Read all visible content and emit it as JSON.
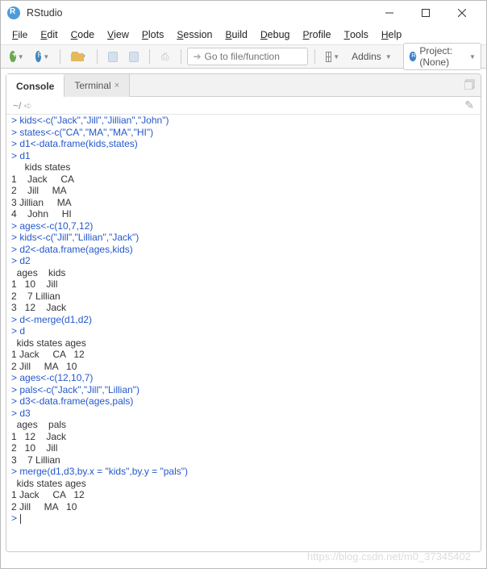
{
  "window": {
    "title": "RStudio"
  },
  "menu": {
    "file": "File",
    "edit": "Edit",
    "code": "Code",
    "view": "View",
    "plots": "Plots",
    "session": "Session",
    "build": "Build",
    "debug": "Debug",
    "profile": "Profile",
    "tools": "Tools",
    "help": "Help"
  },
  "toolbar": {
    "go_placeholder": "Go to file/function",
    "addins": "Addins",
    "project_label": "Project: (None)"
  },
  "tabs": {
    "console": "Console",
    "terminal": "Terminal"
  },
  "subbar": {
    "path": "~/"
  },
  "console_lines": [
    {
      "t": "p",
      "s": "> kids<-c(\"Jack\",\"Jill\",\"Jillian\",\"John\")"
    },
    {
      "t": "p",
      "s": "> states<-c(\"CA\",\"MA\",\"MA\",\"HI\")"
    },
    {
      "t": "p",
      "s": "> d1<-data.frame(kids,states)"
    },
    {
      "t": "p",
      "s": "> d1"
    },
    {
      "t": "o",
      "s": "     kids states"
    },
    {
      "t": "o",
      "s": "1    Jack     CA"
    },
    {
      "t": "o",
      "s": "2    Jill     MA"
    },
    {
      "t": "o",
      "s": "3 Jillian     MA"
    },
    {
      "t": "o",
      "s": "4    John     HI"
    },
    {
      "t": "p",
      "s": "> ages<-c(10,7,12)"
    },
    {
      "t": "p",
      "s": "> kids<-c(\"Jill\",\"Lillian\",\"Jack\")"
    },
    {
      "t": "p",
      "s": "> d2<-data.frame(ages,kids)"
    },
    {
      "t": "p",
      "s": "> d2"
    },
    {
      "t": "o",
      "s": "  ages    kids"
    },
    {
      "t": "o",
      "s": "1   10    Jill"
    },
    {
      "t": "o",
      "s": "2    7 Lillian"
    },
    {
      "t": "o",
      "s": "3   12    Jack"
    },
    {
      "t": "p",
      "s": "> d<-merge(d1,d2)"
    },
    {
      "t": "p",
      "s": "> d"
    },
    {
      "t": "o",
      "s": "  kids states ages"
    },
    {
      "t": "o",
      "s": "1 Jack     CA   12"
    },
    {
      "t": "o",
      "s": "2 Jill     MA   10"
    },
    {
      "t": "p",
      "s": "> ages<-c(12,10,7)"
    },
    {
      "t": "p",
      "s": "> pals<-c(\"Jack\",\"Jill\",\"Lillian\")"
    },
    {
      "t": "p",
      "s": "> d3<-data.frame(ages,pals)"
    },
    {
      "t": "p",
      "s": "> d3"
    },
    {
      "t": "o",
      "s": "  ages    pals"
    },
    {
      "t": "o",
      "s": "1   12    Jack"
    },
    {
      "t": "o",
      "s": "2   10    Jill"
    },
    {
      "t": "o",
      "s": "3    7 Lillian"
    },
    {
      "t": "p",
      "s": "> merge(d1,d3,by.x = \"kids\",by.y = \"pals\")"
    },
    {
      "t": "o",
      "s": "  kids states ages"
    },
    {
      "t": "o",
      "s": "1 Jack     CA   12"
    },
    {
      "t": "o",
      "s": "2 Jill     MA   10"
    },
    {
      "t": "p",
      "s": "> "
    }
  ],
  "watermark": "https://blog.csdn.net/m0_37345402"
}
